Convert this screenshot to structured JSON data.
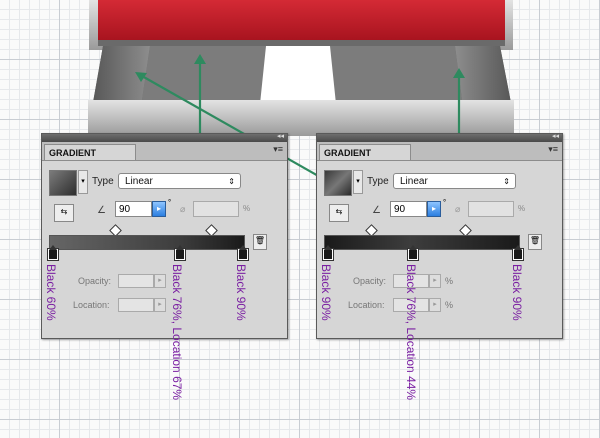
{
  "colors": {
    "purple": "#7a1fa2",
    "arrow": "#2e8a5f",
    "red": "#c0202c"
  },
  "panels": [
    {
      "tab_title": "GRADIENT",
      "collapse_icon": "◂◂",
      "menu_icon": "▾≡",
      "type_label": "Type",
      "type_value": "Linear",
      "angle_value": "90",
      "degree_symbol": "°",
      "aspect_unit": "%",
      "opacity_label": "Opacity:",
      "location_label": "Location:",
      "opacity_unit": "",
      "location_unit": "",
      "stops": [
        {
          "label": "Black 60%"
        },
        {
          "label": "Black 76%, Location 67%"
        },
        {
          "label": "Black 90%"
        }
      ]
    },
    {
      "tab_title": "GRADIENT",
      "collapse_icon": "◂◂",
      "menu_icon": "▾≡",
      "type_label": "Type",
      "type_value": "Linear",
      "angle_value": "90",
      "degree_symbol": "°",
      "aspect_unit": "%",
      "opacity_label": "Opacity:",
      "location_label": "Location:",
      "opacity_unit": "%",
      "location_unit": "%",
      "stops": [
        {
          "label": "Black 90%"
        },
        {
          "label": "Black 76%, Location 44%"
        },
        {
          "label": "Black 90%"
        }
      ]
    }
  ]
}
